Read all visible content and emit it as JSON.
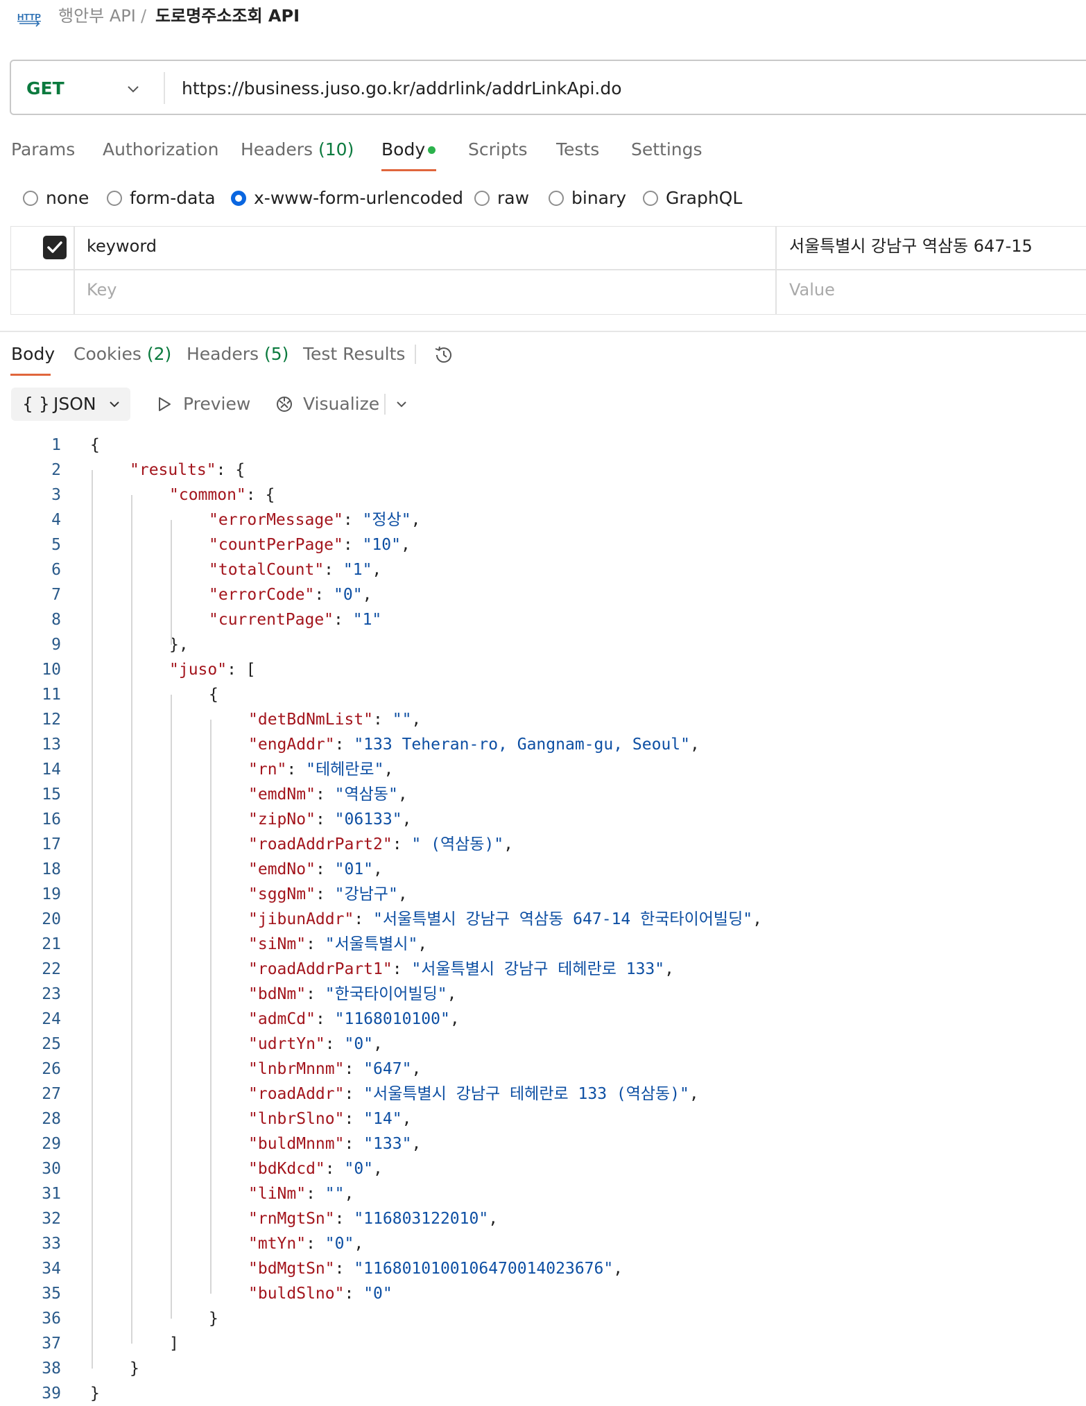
{
  "breadcrumb": {
    "icon": "http-icon",
    "parent": "행안부 API",
    "separator": "/",
    "title": "도로명주소조회 API"
  },
  "request": {
    "method": "GET",
    "url": "https://business.juso.go.kr/addrlink/addrLinkApi.do"
  },
  "request_tabs": {
    "params": "Params",
    "authorization": "Authorization",
    "headers": "Headers",
    "headers_count": "(10)",
    "body": "Body",
    "scripts": "Scripts",
    "tests": "Tests",
    "settings": "Settings"
  },
  "body_types": {
    "none": "none",
    "form_data": "form-data",
    "urlencoded": "x-www-form-urlencoded",
    "raw": "raw",
    "binary": "binary",
    "graphql": "GraphQL",
    "selected": "x-www-form-urlencoded"
  },
  "form_rows": {
    "row1": {
      "checked": true,
      "key": "keyword",
      "value": "서울특별시 강남구 역삼동 647-15"
    },
    "placeholder": {
      "key": "Key",
      "value": "Value"
    }
  },
  "response_tabs": {
    "body": "Body",
    "cookies": "Cookies",
    "cookies_count": "(2)",
    "headers": "Headers",
    "headers_count": "(5)",
    "test_results": "Test Results"
  },
  "format_bar": {
    "braces": "{ }",
    "format": "JSON",
    "preview": "Preview",
    "visualize": "Visualize"
  },
  "code": {
    "lines": [
      [
        {
          "t": "p",
          "s": "{"
        }
      ],
      [
        {
          "t": "k",
          "s": "\"results\""
        },
        {
          "t": "p",
          "s": ": {"
        }
      ],
      [
        {
          "t": "k",
          "s": "\"common\""
        },
        {
          "t": "p",
          "s": ": {"
        }
      ],
      [
        {
          "t": "k",
          "s": "\"errorMessage\""
        },
        {
          "t": "p",
          "s": ": "
        },
        {
          "t": "v",
          "s": "\"정상\""
        },
        {
          "t": "p",
          "s": ","
        }
      ],
      [
        {
          "t": "k",
          "s": "\"countPerPage\""
        },
        {
          "t": "p",
          "s": ": "
        },
        {
          "t": "v",
          "s": "\"10\""
        },
        {
          "t": "p",
          "s": ","
        }
      ],
      [
        {
          "t": "k",
          "s": "\"totalCount\""
        },
        {
          "t": "p",
          "s": ": "
        },
        {
          "t": "v",
          "s": "\"1\""
        },
        {
          "t": "p",
          "s": ","
        }
      ],
      [
        {
          "t": "k",
          "s": "\"errorCode\""
        },
        {
          "t": "p",
          "s": ": "
        },
        {
          "t": "v",
          "s": "\"0\""
        },
        {
          "t": "p",
          "s": ","
        }
      ],
      [
        {
          "t": "k",
          "s": "\"currentPage\""
        },
        {
          "t": "p",
          "s": ": "
        },
        {
          "t": "v",
          "s": "\"1\""
        }
      ],
      [
        {
          "t": "p",
          "s": "},"
        }
      ],
      [
        {
          "t": "k",
          "s": "\"juso\""
        },
        {
          "t": "p",
          "s": ": ["
        }
      ],
      [
        {
          "t": "p",
          "s": "{"
        }
      ],
      [
        {
          "t": "k",
          "s": "\"detBdNmList\""
        },
        {
          "t": "p",
          "s": ": "
        },
        {
          "t": "v",
          "s": "\"\""
        },
        {
          "t": "p",
          "s": ","
        }
      ],
      [
        {
          "t": "k",
          "s": "\"engAddr\""
        },
        {
          "t": "p",
          "s": ": "
        },
        {
          "t": "v",
          "s": "\"133 Teheran-ro, Gangnam-gu, Seoul\""
        },
        {
          "t": "p",
          "s": ","
        }
      ],
      [
        {
          "t": "k",
          "s": "\"rn\""
        },
        {
          "t": "p",
          "s": ": "
        },
        {
          "t": "v",
          "s": "\"테헤란로\""
        },
        {
          "t": "p",
          "s": ","
        }
      ],
      [
        {
          "t": "k",
          "s": "\"emdNm\""
        },
        {
          "t": "p",
          "s": ": "
        },
        {
          "t": "v",
          "s": "\"역삼동\""
        },
        {
          "t": "p",
          "s": ","
        }
      ],
      [
        {
          "t": "k",
          "s": "\"zipNo\""
        },
        {
          "t": "p",
          "s": ": "
        },
        {
          "t": "v",
          "s": "\"06133\""
        },
        {
          "t": "p",
          "s": ","
        }
      ],
      [
        {
          "t": "k",
          "s": "\"roadAddrPart2\""
        },
        {
          "t": "p",
          "s": ": "
        },
        {
          "t": "v",
          "s": "\" (역삼동)\""
        },
        {
          "t": "p",
          "s": ","
        }
      ],
      [
        {
          "t": "k",
          "s": "\"emdNo\""
        },
        {
          "t": "p",
          "s": ": "
        },
        {
          "t": "v",
          "s": "\"01\""
        },
        {
          "t": "p",
          "s": ","
        }
      ],
      [
        {
          "t": "k",
          "s": "\"sggNm\""
        },
        {
          "t": "p",
          "s": ": "
        },
        {
          "t": "v",
          "s": "\"강남구\""
        },
        {
          "t": "p",
          "s": ","
        }
      ],
      [
        {
          "t": "k",
          "s": "\"jibunAddr\""
        },
        {
          "t": "p",
          "s": ": "
        },
        {
          "t": "v",
          "s": "\"서울특별시 강남구 역삼동 647-14 한국타이어빌딩\""
        },
        {
          "t": "p",
          "s": ","
        }
      ],
      [
        {
          "t": "k",
          "s": "\"siNm\""
        },
        {
          "t": "p",
          "s": ": "
        },
        {
          "t": "v",
          "s": "\"서울특별시\""
        },
        {
          "t": "p",
          "s": ","
        }
      ],
      [
        {
          "t": "k",
          "s": "\"roadAddrPart1\""
        },
        {
          "t": "p",
          "s": ": "
        },
        {
          "t": "v",
          "s": "\"서울특별시 강남구 테헤란로 133\""
        },
        {
          "t": "p",
          "s": ","
        }
      ],
      [
        {
          "t": "k",
          "s": "\"bdNm\""
        },
        {
          "t": "p",
          "s": ": "
        },
        {
          "t": "v",
          "s": "\"한국타이어빌딩\""
        },
        {
          "t": "p",
          "s": ","
        }
      ],
      [
        {
          "t": "k",
          "s": "\"admCd\""
        },
        {
          "t": "p",
          "s": ": "
        },
        {
          "t": "v",
          "s": "\"1168010100\""
        },
        {
          "t": "p",
          "s": ","
        }
      ],
      [
        {
          "t": "k",
          "s": "\"udrtYn\""
        },
        {
          "t": "p",
          "s": ": "
        },
        {
          "t": "v",
          "s": "\"0\""
        },
        {
          "t": "p",
          "s": ","
        }
      ],
      [
        {
          "t": "k",
          "s": "\"lnbrMnnm\""
        },
        {
          "t": "p",
          "s": ": "
        },
        {
          "t": "v",
          "s": "\"647\""
        },
        {
          "t": "p",
          "s": ","
        }
      ],
      [
        {
          "t": "k",
          "s": "\"roadAddr\""
        },
        {
          "t": "p",
          "s": ": "
        },
        {
          "t": "v",
          "s": "\"서울특별시 강남구 테헤란로 133 (역삼동)\""
        },
        {
          "t": "p",
          "s": ","
        }
      ],
      [
        {
          "t": "k",
          "s": "\"lnbrSlno\""
        },
        {
          "t": "p",
          "s": ": "
        },
        {
          "t": "v",
          "s": "\"14\""
        },
        {
          "t": "p",
          "s": ","
        }
      ],
      [
        {
          "t": "k",
          "s": "\"buldMnnm\""
        },
        {
          "t": "p",
          "s": ": "
        },
        {
          "t": "v",
          "s": "\"133\""
        },
        {
          "t": "p",
          "s": ","
        }
      ],
      [
        {
          "t": "k",
          "s": "\"bdKdcd\""
        },
        {
          "t": "p",
          "s": ": "
        },
        {
          "t": "v",
          "s": "\"0\""
        },
        {
          "t": "p",
          "s": ","
        }
      ],
      [
        {
          "t": "k",
          "s": "\"liNm\""
        },
        {
          "t": "p",
          "s": ": "
        },
        {
          "t": "v",
          "s": "\"\""
        },
        {
          "t": "p",
          "s": ","
        }
      ],
      [
        {
          "t": "k",
          "s": "\"rnMgtSn\""
        },
        {
          "t": "p",
          "s": ": "
        },
        {
          "t": "v",
          "s": "\"116803122010\""
        },
        {
          "t": "p",
          "s": ","
        }
      ],
      [
        {
          "t": "k",
          "s": "\"mtYn\""
        },
        {
          "t": "p",
          "s": ": "
        },
        {
          "t": "v",
          "s": "\"0\""
        },
        {
          "t": "p",
          "s": ","
        }
      ],
      [
        {
          "t": "k",
          "s": "\"bdMgtSn\""
        },
        {
          "t": "p",
          "s": ": "
        },
        {
          "t": "v",
          "s": "\"1168010100106470014023676\""
        },
        {
          "t": "p",
          "s": ","
        }
      ],
      [
        {
          "t": "k",
          "s": "\"buldSlno\""
        },
        {
          "t": "p",
          "s": ": "
        },
        {
          "t": "v",
          "s": "\"0\""
        }
      ],
      [
        {
          "t": "p",
          "s": "}"
        }
      ],
      [
        {
          "t": "p",
          "s": "]"
        }
      ],
      [
        {
          "t": "p",
          "s": "}"
        }
      ],
      [
        {
          "t": "p",
          "s": "}"
        }
      ]
    ]
  },
  "colors": {
    "method_get": "#0b7a3e",
    "tab_accent": "#e0663c",
    "radio_selected": "#0a66e0",
    "json_key": "#a3151d",
    "json_value": "#0d4fa3",
    "count_green": "#0b7a3e"
  }
}
